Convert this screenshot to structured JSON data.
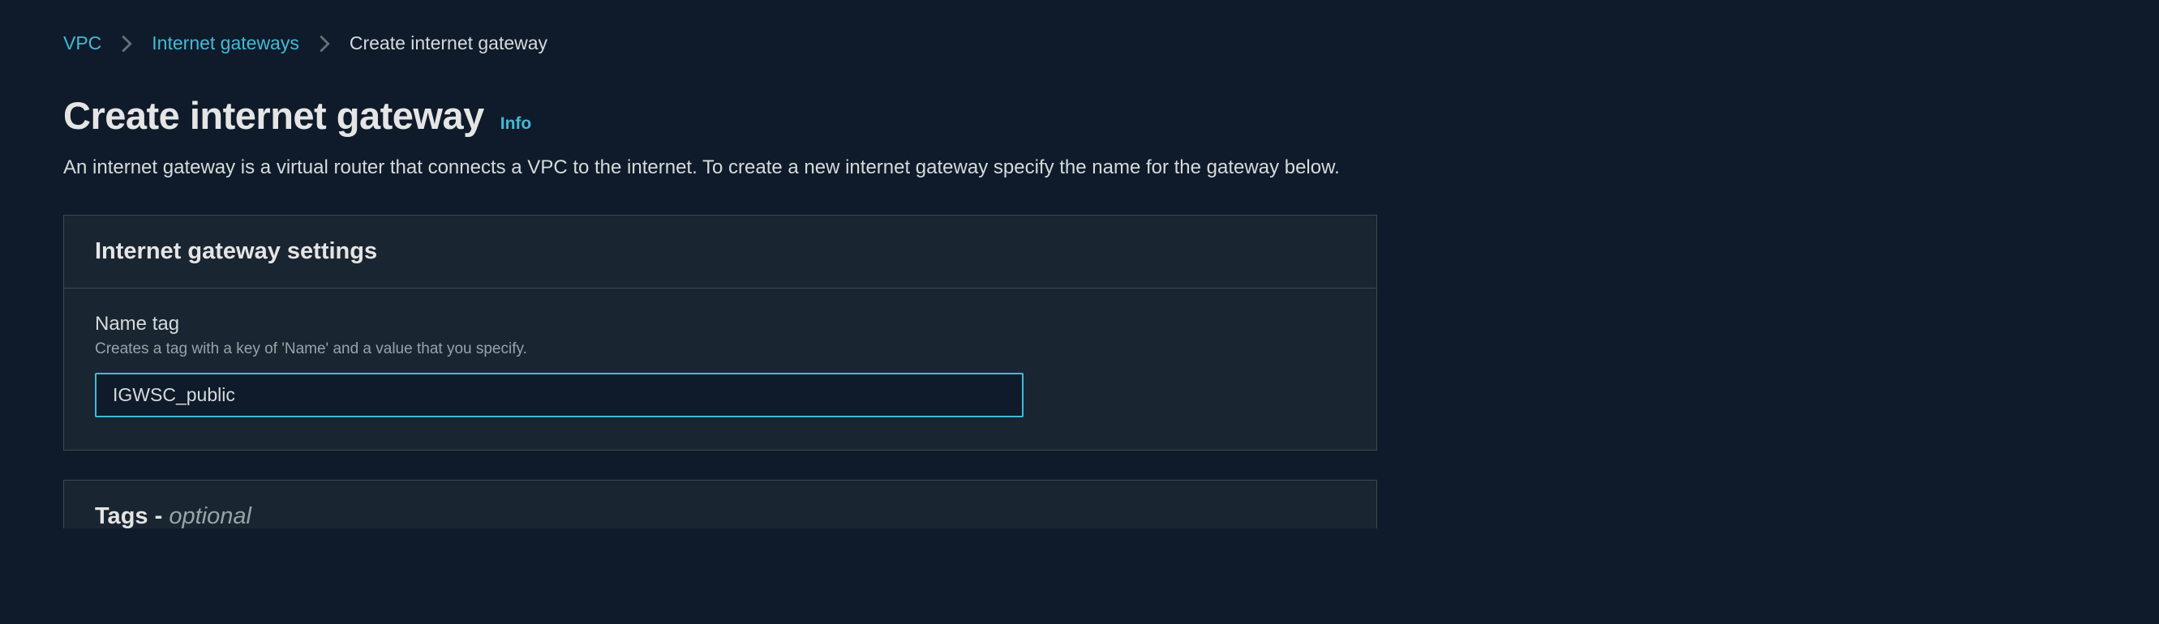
{
  "breadcrumb": {
    "vpc": "VPC",
    "igw": "Internet gateways",
    "current": "Create internet gateway"
  },
  "header": {
    "title": "Create internet gateway",
    "info": "Info"
  },
  "description": "An internet gateway is a virtual router that connects a VPC to the internet. To create a new internet gateway specify the name for the gateway below.",
  "settings": {
    "panel_title": "Internet gateway settings",
    "name_tag_label": "Name tag",
    "name_tag_help": "Creates a tag with a key of 'Name' and a value that you specify.",
    "name_tag_value": "IGWSC_public"
  },
  "tags": {
    "panel_title_main": "Tags - ",
    "panel_title_optional": "optional"
  }
}
